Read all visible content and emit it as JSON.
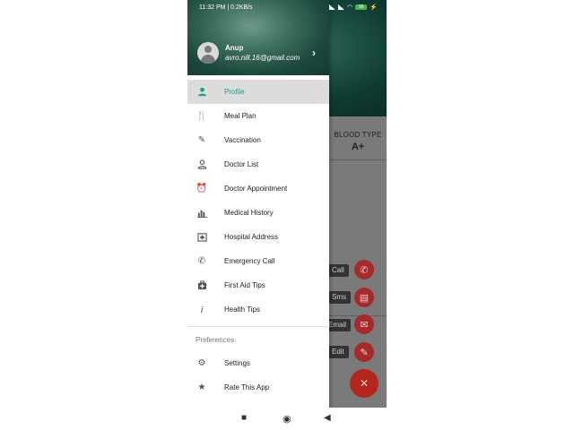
{
  "status_bar": {
    "time": "11:32 PM | 0.2KB/s",
    "battery": "96"
  },
  "drawer": {
    "user_name": "Anup",
    "user_email": "avro.nill.16@gmail.com",
    "menu_items": [
      {
        "label": "Profile",
        "icon": "person-icon"
      },
      {
        "label": "Meal Plan",
        "icon": "fork-knife-icon"
      },
      {
        "label": "Vaccination",
        "icon": "syringe-icon"
      },
      {
        "label": "Doctor List",
        "icon": "doctor-icon"
      },
      {
        "label": "Doctor Appointment",
        "icon": "alarm-clock-icon"
      },
      {
        "label": "Medical History",
        "icon": "bar-chart-icon"
      },
      {
        "label": "Hospital Address",
        "icon": "hospital-icon"
      },
      {
        "label": "Emergency Call",
        "icon": "phone-icon"
      },
      {
        "label": "First Aid Tips",
        "icon": "medical-kit-icon"
      },
      {
        "label": "Health Tips",
        "icon": "info-icon"
      }
    ],
    "preferences_label": "Preferences",
    "preference_items": [
      {
        "label": "Settings",
        "icon": "gear-icon"
      },
      {
        "label": "Rate This App",
        "icon": "star-icon"
      }
    ]
  },
  "background": {
    "blood_type_label": "BLOOD TYPE",
    "blood_type_value": "A+",
    "fab_labels": [
      "Call",
      "Sms",
      "Email",
      "Edit"
    ]
  },
  "colors": {
    "accent": "#1aa085",
    "fab": "#b3261e"
  }
}
